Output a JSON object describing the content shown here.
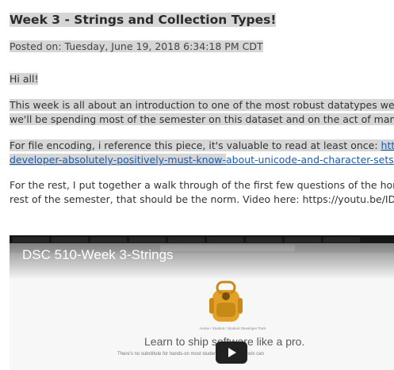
{
  "post": {
    "title": "Week 3 - Strings and Collection Types!",
    "posted": "Posted on: Tuesday, June 19, 2018 6:34:18 PM CDT",
    "greeting": "Hi all!",
    "para1_line1": "This week is all about an introduction to one of the most robust datatypes we'll c",
    "para1_line2": "we'll be spending most of the semester on this dataset and on the act of manipu",
    "para2_prefix": "For file encoding, i reference this piece, it's valuable to read at least once: ",
    "para2_link1": "https:/",
    "para2_link2a": "developer-absolutely-positively-must-know-",
    "para2_link2b": "about-unicode-and-character-sets-no",
    "para3_line1": "For the rest, I put together a walk through of the first few questions of the home",
    "para3_line2": "rest of the semester, that should be the norm. Video here: https://youtu.be/IDUX"
  },
  "video": {
    "title": "DSC 510-Week 3-Strings",
    "breadcrumb": "Home  /  Student  /  Student Developer Pack",
    "tagline": "Learn to ship software like a pro.",
    "subline": "There's no substitute for hands-on                                    most students, real world tools can",
    "play_icon": "play-button-icon"
  },
  "colors": {
    "highlight": "#d6d6d6",
    "link": "#1a5cb0"
  }
}
